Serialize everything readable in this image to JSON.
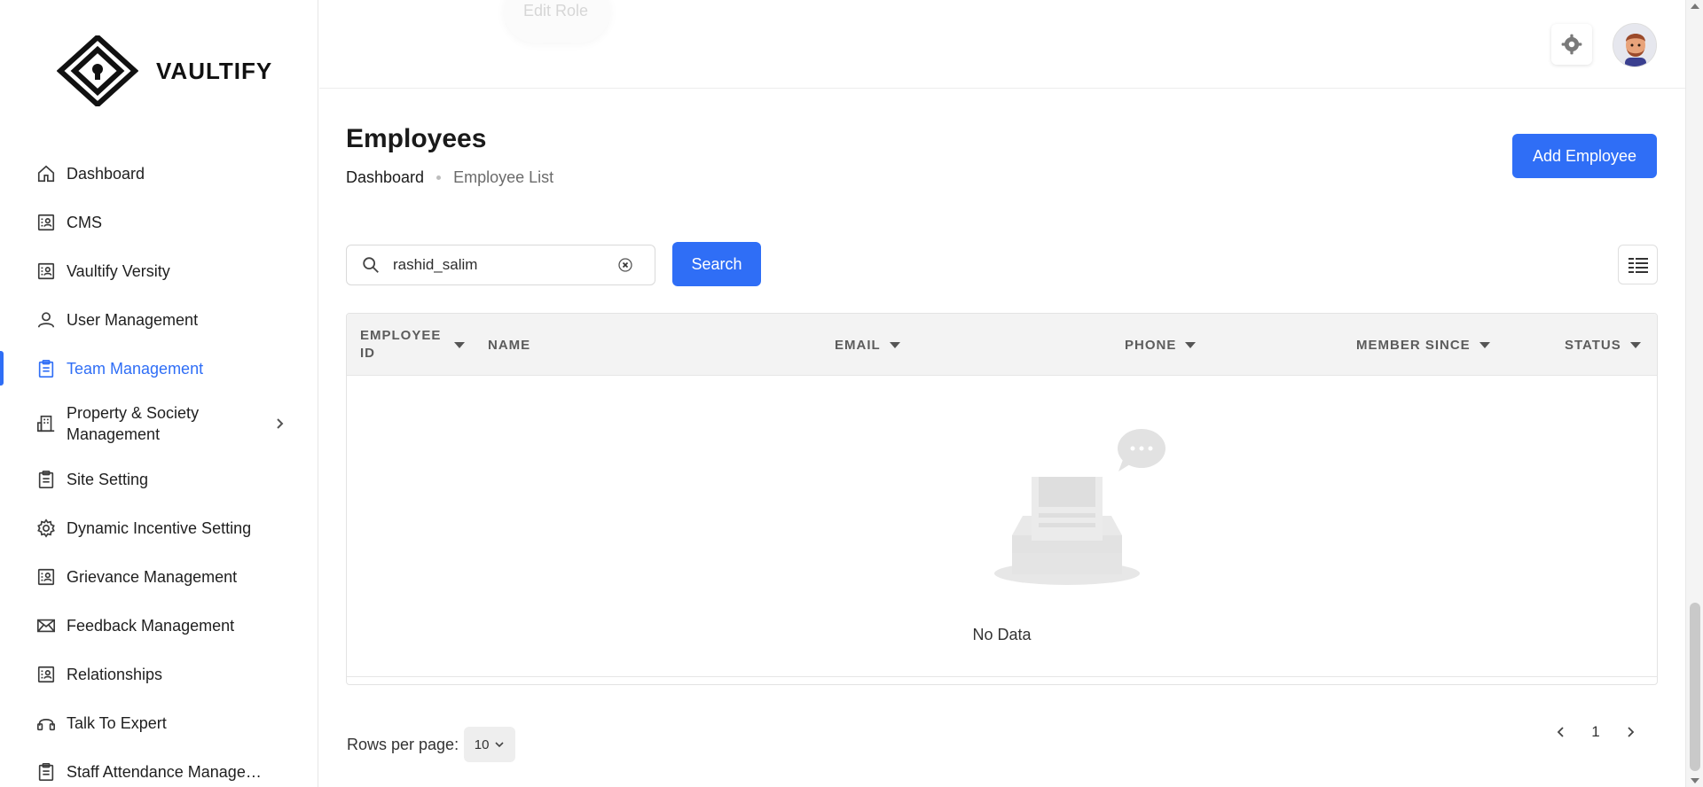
{
  "brand": {
    "name": "VAULTIFY"
  },
  "sidebar": {
    "items": [
      {
        "label": "Dashboard",
        "icon": "home-icon"
      },
      {
        "label": "CMS",
        "icon": "contact-card-icon"
      },
      {
        "label": "Vaultify Versity",
        "icon": "contact-card-icon"
      },
      {
        "label": "User Management",
        "icon": "user-icon"
      },
      {
        "label": "Team Management",
        "icon": "clipboard-icon"
      },
      {
        "label": "Property & Society Management",
        "icon": "building-icon"
      },
      {
        "label": "Site Setting",
        "icon": "clipboard-icon"
      },
      {
        "label": "Dynamic Incentive Setting",
        "icon": "gear-icon"
      },
      {
        "label": "Grievance Management",
        "icon": "contact-card-icon"
      },
      {
        "label": "Feedback Management",
        "icon": "mail-icon"
      },
      {
        "label": "Relationships",
        "icon": "contact-card-icon"
      },
      {
        "label": "Talk To Expert",
        "icon": "headset-icon"
      },
      {
        "label": "Staff Attendance Manage…",
        "icon": "clipboard-icon"
      }
    ],
    "active_index": 4
  },
  "topbar": {
    "ghost_label": "Edit Role"
  },
  "page": {
    "title": "Employees",
    "breadcrumb": {
      "home": "Dashboard",
      "current": "Employee List"
    },
    "add_button": "Add Employee"
  },
  "search": {
    "value": "rashid_salim",
    "button": "Search"
  },
  "table": {
    "columns": [
      "EMPLOYEE ID",
      "NAME",
      "EMAIL",
      "PHONE",
      "MEMBER SINCE",
      "STATUS"
    ],
    "empty_text": "No Data"
  },
  "pagination": {
    "rows_label": "Rows per page:",
    "rows_value": "10",
    "current_page": "1"
  },
  "colors": {
    "accent": "#2f6ef6"
  }
}
